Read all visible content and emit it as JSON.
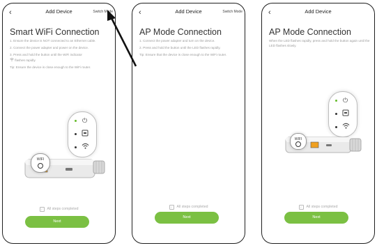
{
  "header": {
    "back_icon": "‹",
    "title": "Add Device",
    "switch_mode": "Switch Mode"
  },
  "panel1": {
    "title": "Smart WiFi Connection",
    "steps": [
      "1. Ensure the device is NOT connected to an Ethernet cable.",
      "2. Connect the power adapter and power on the device.",
      "3. Press and hold the button until the WiFi indicator",
      "flashes rapidly."
    ],
    "tip": "Tip: Ensure the device is close enough to the WiFi router.",
    "wifi_label": "WIFI"
  },
  "panel2": {
    "title": "AP Mode Connection",
    "steps": [
      "1. Connect the power adapter and turn on the device.",
      "2. Press and hold the button until the LED flashes rapidly."
    ],
    "tip": "Tip: Ensure that the device is close enough to the WiFi router."
  },
  "panel3": {
    "title": "AP Mode Connection",
    "steps": [
      "When the LED flashes rapidly, press and hold the button again until the LED  flashes slowly."
    ],
    "wifi_label": "WIFI"
  },
  "footer": {
    "all_steps": "All steps completed",
    "next": "Next"
  },
  "colors": {
    "accent": "#7bc043",
    "led": "#66bb2a"
  },
  "icons": [
    "back-icon",
    "power-icon",
    "ethernet-icon",
    "wifi-icon",
    "checkbox-icon",
    "arrow-icon"
  ]
}
